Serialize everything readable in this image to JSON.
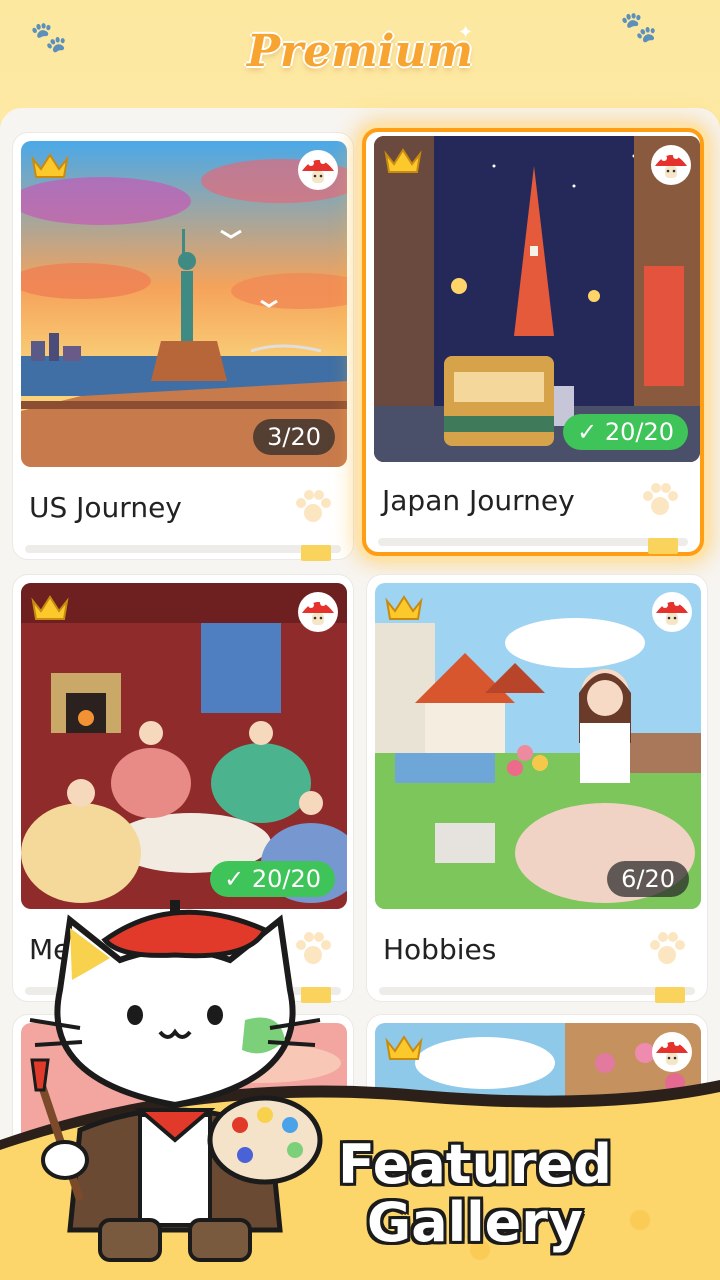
{
  "header": {
    "title": "Premium"
  },
  "cards": [
    {
      "title": "US Journey",
      "progress": "3/20",
      "complete": false,
      "premium": true
    },
    {
      "title": "Japan Journey",
      "progress": "20/20",
      "complete": true,
      "premium": true,
      "selected": true
    },
    {
      "title": "Medieval",
      "visible_title": "Med",
      "progress": "20/20",
      "complete": true,
      "premium": true
    },
    {
      "title": "Hobbies",
      "progress": "6/20",
      "complete": false,
      "premium": true
    }
  ],
  "banner": {
    "line1": "Featured",
    "line2": "Gallery"
  },
  "icons": {
    "premium": "crown-icon",
    "hint": "mushroom-icon",
    "done": "check-icon",
    "decor": "paw-icon"
  },
  "colors": {
    "accent": "#ff9d14",
    "complete": "#3fc45a",
    "background": "#fde8a0"
  }
}
